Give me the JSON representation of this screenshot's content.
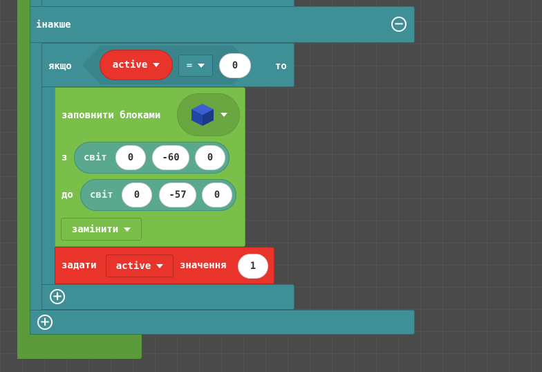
{
  "blocks": {
    "else_label": "інакше",
    "if_label": "якщо",
    "then_label": "то",
    "condition": {
      "variable": "active",
      "operator": "=",
      "value": "0"
    },
    "fill": {
      "label": "заповнити блоками",
      "block_icon": "blue-cube-icon",
      "from_label": "з",
      "to_label": "до",
      "world_label": "світ",
      "from": [
        "0",
        "-60",
        "0"
      ],
      "to": [
        "0",
        "-57",
        "0"
      ],
      "mode": "замінити"
    },
    "set": {
      "label": "задати",
      "variable": "active",
      "value_label": "значення",
      "value": "1"
    }
  },
  "colors": {
    "background": "#4a4a4a",
    "logic": "#3f8f96",
    "blocks": "#7bbf4b",
    "variables": "#e8342a",
    "outer_green": "#5a9a3a"
  }
}
